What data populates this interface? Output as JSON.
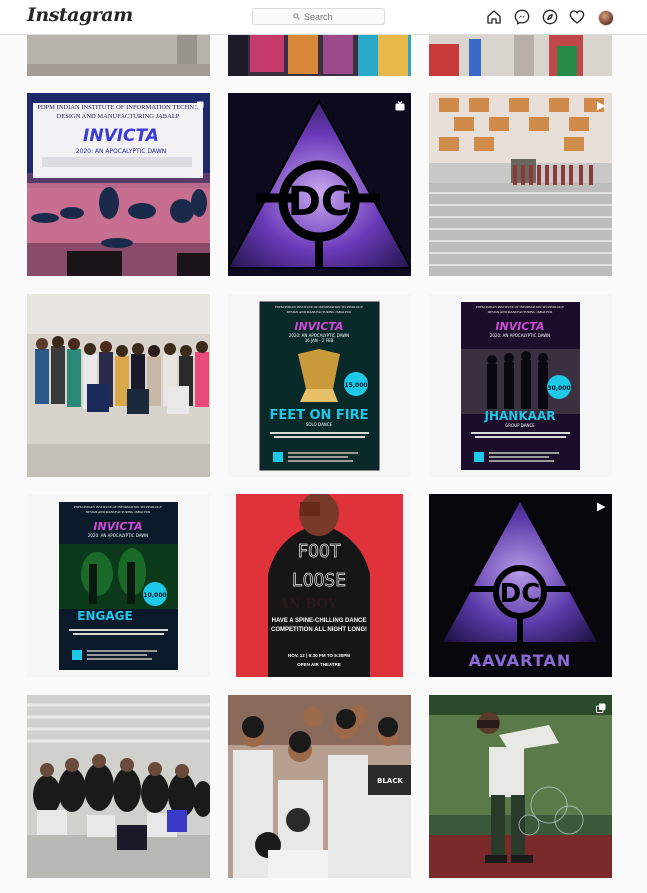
{
  "header": {
    "logo": "Instagram",
    "search_placeholder": "Search",
    "icons": [
      "home-icon",
      "messenger-icon",
      "explore-icon",
      "heart-icon",
      "profile-avatar"
    ]
  },
  "grid": {
    "posts": [
      {
        "name": "post-crowd-dance-1",
        "badge": "none"
      },
      {
        "name": "post-crowd-dance-2",
        "badge": "none"
      },
      {
        "name": "post-crowd-dance-3",
        "badge": "none"
      },
      {
        "name": "post-stage-performance",
        "badge": "carousel"
      },
      {
        "name": "post-dc-logo-galaxy",
        "badge": "igtv"
      },
      {
        "name": "post-group-on-steps",
        "badge": "video"
      },
      {
        "name": "post-team-group-photo",
        "badge": "none"
      },
      {
        "name": "post-feet-on-fire-poster",
        "badge": "none"
      },
      {
        "name": "post-jhankaar-poster",
        "badge": "none"
      },
      {
        "name": "post-engage-poster",
        "badge": "none"
      },
      {
        "name": "post-foot-loose-poster",
        "badge": "none"
      },
      {
        "name": "post-aavartan-logo",
        "badge": "video"
      },
      {
        "name": "post-group-cheering",
        "badge": "none"
      },
      {
        "name": "post-friends-heart-hands",
        "badge": "none"
      },
      {
        "name": "post-dab-on-stage",
        "badge": "carousel"
      }
    ],
    "poster_texts": {
      "header_line1": "PDPM INDIAN INSTITUTE OF INFORMATION TECHNOLOGY",
      "header_line2": "DESIGN AND MANUFACTURING JABALPUR",
      "presents": "PRESENTS",
      "event_logo": "INVICTA",
      "subtitle": "2020: AN APOCALYPTIC DAWN",
      "dates": "16 JAN - 2 FEB",
      "feet_title": "FEET ON FIRE",
      "feet_sub": "SOLO DANCE",
      "feet_prize": "15,000",
      "jhankaar_title": "JHANKAAR",
      "jhankaar_sub": "GROUP DANCE",
      "jhankaar_prize": "30,000",
      "engage_title": "ENGAGE",
      "engage_prize": "10,000",
      "prize_label": "PRIZES WORTH",
      "stage_banner_top": "PDPM INDIAN INSTITUTE OF INFORMATION TECHNO",
      "stage_banner_mid": "DESIGN AND MANUFACTURING JABALP",
      "stage_logo": "INVICTA",
      "stage_sub": "2020: AN APOCALYPTIC DAWN",
      "dc_mark": "DC",
      "foot1": "FOOT",
      "foot2": "LOOSE",
      "foot_tag": "SPINE-CHILLING DANCE",
      "foot_l1": "HAVE A SPINE-CHILLING DANCE",
      "foot_l2": "COMPETITION ALL NIGHT LONG!",
      "foot_date": "NOV. 12 | 6:30 PM TO 9:30PM",
      "foot_venue": "OPEN AIR THEATRE",
      "aavartan": "AAVARTAN",
      "shirt_text": "BLACK"
    }
  },
  "colors": {
    "accent_cyan": "#1ec8e8",
    "accent_magenta": "#d04ad8",
    "foot_red": "#e0323a",
    "purple_galaxy": "#5a3aa8"
  }
}
